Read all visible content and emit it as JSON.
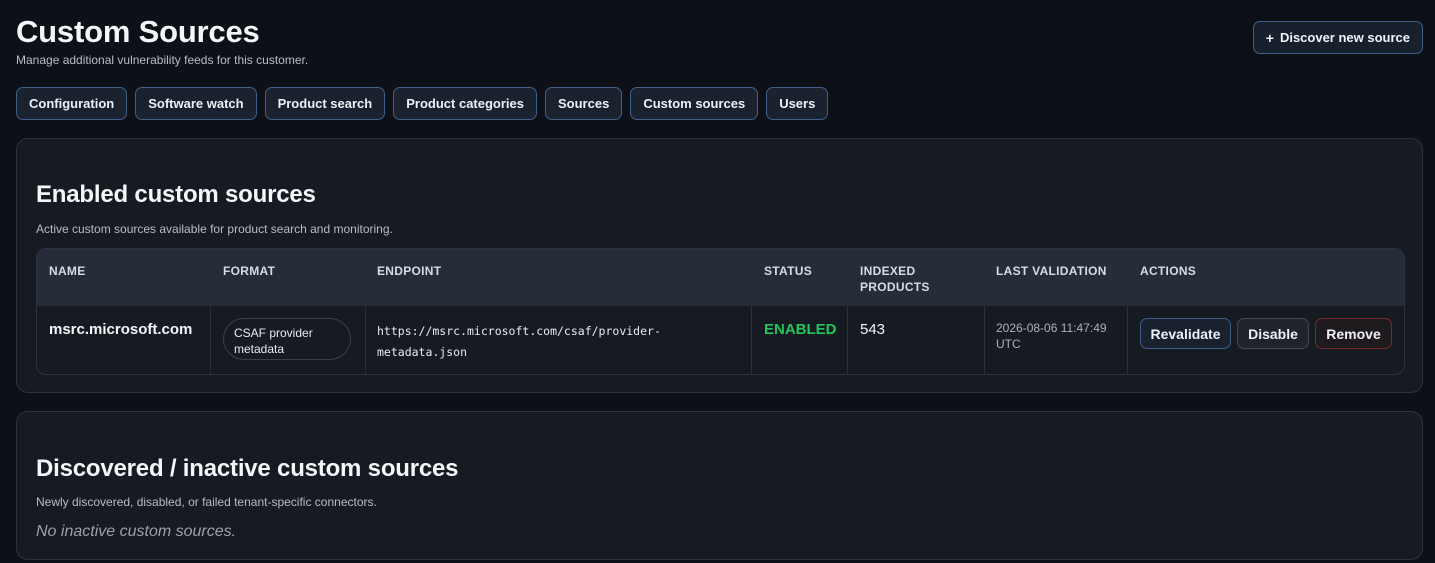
{
  "header": {
    "title": "Custom Sources",
    "subtitle": "Manage additional vulnerability feeds for this customer.",
    "discover_button": "Discover new source"
  },
  "tabs": [
    {
      "label": "Configuration"
    },
    {
      "label": "Software watch"
    },
    {
      "label": "Product search"
    },
    {
      "label": "Product categories"
    },
    {
      "label": "Sources"
    },
    {
      "label": "Custom sources"
    },
    {
      "label": "Users"
    }
  ],
  "enabled_section": {
    "title": "Enabled custom sources",
    "description": "Active custom sources available for product search and monitoring.",
    "columns": [
      "Name",
      "Format",
      "Endpoint",
      "Status",
      "Indexed products",
      "Last validation",
      "Actions"
    ],
    "rows": [
      {
        "name": "msrc.microsoft.com",
        "format": "CSAF provider metadata",
        "endpoint": "https://msrc.microsoft.com/csaf/provider-metadata.json",
        "status": "ENABLED",
        "indexed_products": "543",
        "last_validation": "2026-08-06 11:47:49 UTC",
        "actions": {
          "revalidate": "Revalidate",
          "disable": "Disable",
          "remove": "Remove"
        }
      }
    ]
  },
  "inactive_section": {
    "title": "Discovered / inactive custom sources",
    "description": "Newly discovered, disabled, or failed tenant-specific connectors.",
    "empty_text": "No inactive custom sources."
  },
  "colors": {
    "background": "#0d1016",
    "card": "#171a21",
    "accent_border": "#3f5f86",
    "status_enabled": "#22c55e",
    "danger_border": "#7a2a2f"
  },
  "icons": {
    "discover": "plus-icon"
  }
}
